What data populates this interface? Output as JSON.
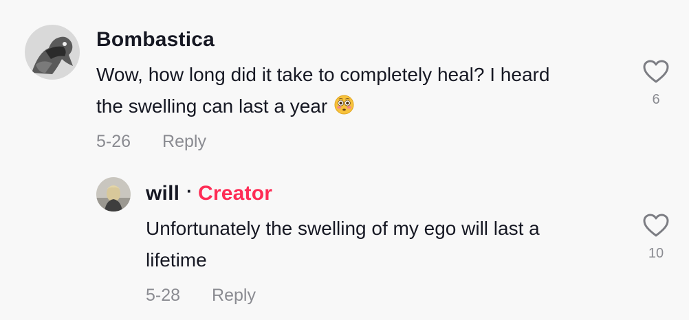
{
  "comments": [
    {
      "username": "Bombastica",
      "text_line1": "Wow, how long did it take to completely heal? I heard",
      "text_line2": "the swelling can last a year",
      "emoji": "flushed-face",
      "date": "5-26",
      "reply_label": "Reply",
      "like_count": "6"
    }
  ],
  "reply": {
    "username": "will",
    "separator": "·",
    "badge": "Creator",
    "text_line1": "Unfortunately the swelling of my ego will last a",
    "text_line2": "lifetime",
    "date": "5-28",
    "reply_label": "Reply",
    "like_count": "10"
  },
  "colors": {
    "background": "#f8f8f8",
    "creator_badge": "#fe2c55",
    "meta_gray": "#8a8b91",
    "text": "#161823"
  }
}
